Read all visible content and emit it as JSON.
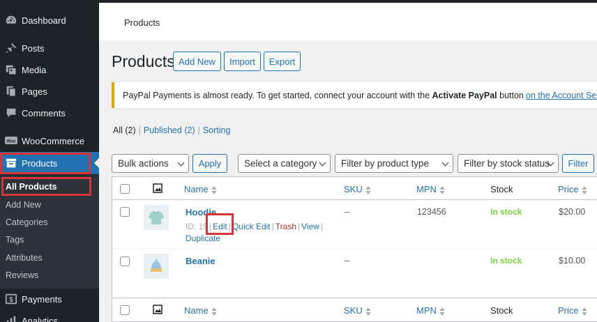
{
  "sidebar": {
    "items": [
      {
        "label": "Dashboard",
        "icon": "dashboard-icon"
      },
      {
        "label": "Posts",
        "icon": "pin-icon"
      },
      {
        "label": "Media",
        "icon": "media-icon"
      },
      {
        "label": "Pages",
        "icon": "pages-icon"
      },
      {
        "label": "Comments",
        "icon": "comment-icon"
      },
      {
        "label": "WooCommerce",
        "icon": "woo-icon"
      },
      {
        "label": "Products",
        "icon": "archive-icon"
      },
      {
        "label": "Payments",
        "icon": "dollar-icon"
      },
      {
        "label": "Analytics",
        "icon": "chart-icon"
      }
    ],
    "submenu": [
      "All Products",
      "Add New",
      "Categories",
      "Tags",
      "Attributes",
      "Reviews"
    ]
  },
  "header": {
    "breadcrumb": "Products"
  },
  "page": {
    "title": "Products",
    "buttons": {
      "add_new": "Add New",
      "import": "Import",
      "export": "Export"
    }
  },
  "notice": {
    "text_before": "PayPal Payments is almost ready. To get started, connect your account with the",
    "bold": "Activate PayPal",
    "text_mid": "button",
    "link": "on the Account Setup page",
    "text_after": "."
  },
  "views": {
    "all": "All",
    "all_count": "(2)",
    "published": "Published",
    "published_count": "(2)",
    "sorting": "Sorting"
  },
  "filters": {
    "bulk_actions": "Bulk actions",
    "apply": "Apply",
    "category": "Select a category",
    "product_type": "Filter by product type",
    "stock_status": "Filter by stock status",
    "filter": "Filter"
  },
  "table": {
    "columns": {
      "name": "Name",
      "sku": "SKU",
      "mpn": "MPN",
      "stock": "Stock",
      "price": "Price"
    },
    "rows": [
      {
        "name": "Hoodie",
        "id_label": "ID: 19",
        "actions": {
          "edit": "Edit",
          "quick_edit": "Quick Edit",
          "trash": "Trash",
          "view": "View",
          "duplicate": "Duplicate"
        },
        "sku": "–",
        "mpn": "123456",
        "stock": "In stock",
        "price": "$20.00"
      },
      {
        "name": "Beanie",
        "sku": "–",
        "mpn": "",
        "stock": "In stock",
        "price": "$10.00"
      }
    ]
  },
  "colors": {
    "accent": "#2271b1",
    "sidebar_bg": "#1d2327",
    "highlight_box": "#d63638",
    "in_stock": "#7ad03a",
    "notice_border": "#dba617"
  }
}
